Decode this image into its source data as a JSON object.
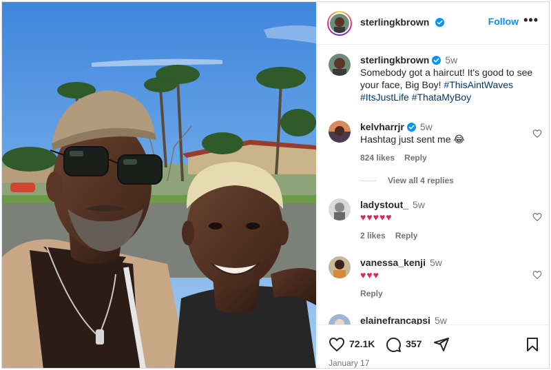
{
  "post": {
    "author": "sterlingkbrown",
    "follow_label": "Follow",
    "more_label": "•••",
    "caption": {
      "author": "sterlingkbrown",
      "time": "5w",
      "text": "Somebody got a haircut! It's good to see your face, Big Boy!",
      "hashtags": [
        "#ThisAintWaves",
        "#ItsJustLife",
        "#ThataMyBoy"
      ]
    }
  },
  "comments": [
    {
      "user": "kelvharrjr",
      "verified": true,
      "time": "5w",
      "text": "Hashtag just sent me 😂",
      "likes": "824 likes",
      "reply": "Reply"
    },
    {
      "user": "ladystout_",
      "verified": false,
      "time": "5w",
      "text": "♥♥♥♥♥",
      "likes": "2 likes",
      "reply": "Reply"
    },
    {
      "user": "vanessa_kenji",
      "verified": false,
      "time": "5w",
      "text": "♥♥♥",
      "likes": "",
      "reply": "Reply"
    },
    {
      "user": "elainefrancapsi",
      "verified": false,
      "time": "5w"
    }
  ],
  "view_replies": "View all 4 replies",
  "actions": {
    "likes_count": "72.1K",
    "comments_count": "357",
    "date": "January 17"
  },
  "colors": {
    "accent": "#0095f6",
    "hashtag": "#00376b",
    "heart_red": "#e0245e",
    "muted": "#737373"
  },
  "icons": [
    "verified-badge-icon",
    "heart-outline-icon",
    "comment-icon",
    "share-icon",
    "bookmark-icon",
    "more-icon"
  ]
}
